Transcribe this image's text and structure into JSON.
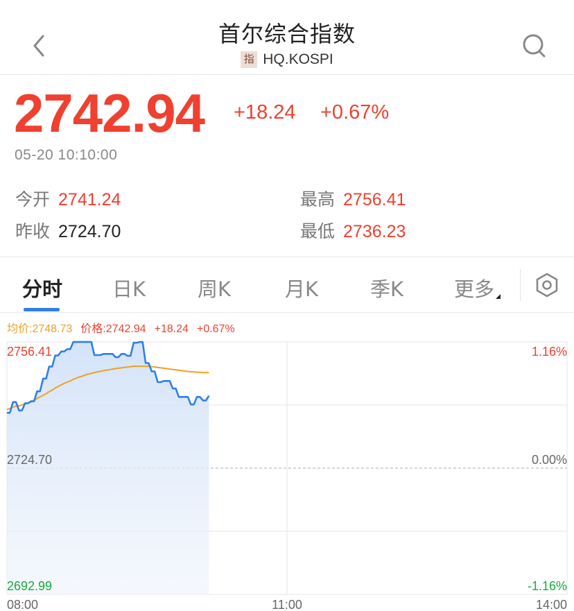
{
  "header": {
    "title": "首尔综合指数",
    "badge": "指",
    "code": "HQ.KOSPI",
    "back_icon": "chevron-left-icon",
    "search_icon": "search-icon"
  },
  "quote": {
    "price": "2742.94",
    "change": "+18.24",
    "change_pct": "+0.67%",
    "timestamp": "05-20 10:10:00"
  },
  "stats": {
    "open_label": "今开",
    "open": "2741.24",
    "high_label": "最高",
    "high": "2756.41",
    "prev_close_label": "昨收",
    "prev_close": "2724.70",
    "low_label": "最低",
    "low": "2736.23"
  },
  "tabs": [
    {
      "label": "分时",
      "active": true
    },
    {
      "label": "日K"
    },
    {
      "label": "周K"
    },
    {
      "label": "月K"
    },
    {
      "label": "季K"
    },
    {
      "label": "更多"
    }
  ],
  "settings_icon": "settings-icon",
  "chart_info": {
    "avg": "均价:2748.73",
    "price": "价格:2742.94",
    "change": "+18.24",
    "change_pct": "+0.67%"
  },
  "chart_data": {
    "type": "line",
    "y_left_labels": [
      "2756.41",
      "2724.70",
      "2692.99"
    ],
    "y_right_labels": [
      "1.16%",
      "0.00%",
      "-1.16%"
    ],
    "x_labels": [
      "08:00",
      "11:00",
      "14:00"
    ],
    "ylim": [
      2692.99,
      2756.41
    ],
    "x_range_minutes": [
      0,
      360
    ],
    "series": [
      {
        "type": "price",
        "values": [
          2738.6,
          2738.6,
          2741.3,
          2741.3,
          2739.2,
          2739.2,
          2741.0,
          2741.0,
          2741.5,
          2741.5,
          2744.0,
          2744.0,
          2747.2,
          2747.2,
          2750.2,
          2750.2,
          2753.0,
          2753.0,
          2754.0,
          2754.0,
          2754.6,
          2754.6,
          2756.4,
          2756.4,
          2756.4,
          2756.4,
          2756.4,
          2756.4,
          2756.4,
          2753.1,
          2753.1,
          2753.1,
          2753.4,
          2753.4,
          2753.4,
          2753.4,
          2752.6,
          2752.6,
          2753.4,
          2753.4,
          2752.9,
          2752.9,
          2756.2,
          2756.2,
          2756.4,
          2756.4,
          2751.1,
          2751.1,
          2749.0,
          2749.0,
          2746.3,
          2746.3,
          2746.6,
          2746.6,
          2746.6,
          2744.7,
          2744.7,
          2742.6,
          2742.6,
          2742.6,
          2742.6,
          2740.7,
          2740.7,
          2742.6,
          2742.6,
          2741.7,
          2741.7,
          2742.9
        ]
      },
      {
        "type": "average",
        "values": [
          2739.4,
          2739.7,
          2740.0,
          2740.3,
          2740.3,
          2740.6,
          2740.8,
          2741.0,
          2741.3,
          2741.7,
          2742.2,
          2742.6,
          2743.0,
          2743.4,
          2743.9,
          2744.3,
          2744.8,
          2745.2,
          2745.6,
          2746.0,
          2746.3,
          2746.6,
          2747.0,
          2747.3,
          2747.6,
          2747.8,
          2748.1,
          2748.3,
          2748.5,
          2748.7,
          2748.9,
          2749.0,
          2749.2,
          2749.3,
          2749.4,
          2749.6,
          2749.7,
          2749.8,
          2749.9,
          2750.0,
          2750.1,
          2750.2,
          2750.3,
          2750.3,
          2750.3,
          2750.3,
          2750.3,
          2750.3,
          2750.2,
          2750.1,
          2750.0,
          2749.9,
          2749.8,
          2749.7,
          2749.6,
          2749.5,
          2749.4,
          2749.3,
          2749.2,
          2749.1,
          2749.0,
          2748.9,
          2748.9,
          2748.8,
          2748.8,
          2748.7,
          2748.7,
          2748.7
        ]
      }
    ],
    "colors": {
      "price": "#2f7fe8",
      "average": "#f0a020",
      "up": "#f0402f",
      "down": "#1aaa3c"
    }
  }
}
